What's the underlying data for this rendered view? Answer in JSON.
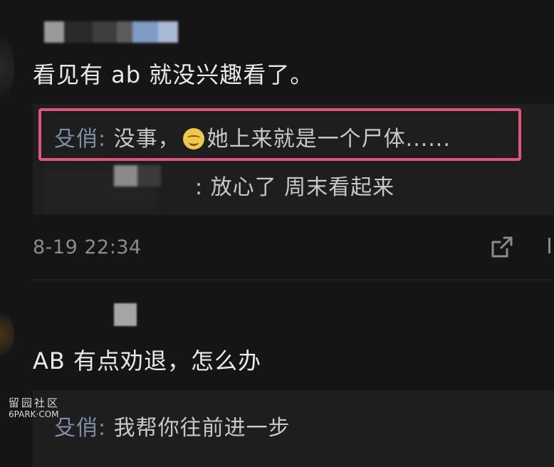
{
  "comments": [
    {
      "text": "看见有 ab 就没兴趣看了。",
      "replies": [
        {
          "author": "殳俏",
          "separator": ":",
          "text_before_emoji": " 没事，",
          "emoji": "smile-emoji",
          "text_after_emoji": "她上来就是一个尸体......"
        },
        {
          "text": ": 放心了  周末看起来"
        }
      ],
      "timestamp": "8-19 22:34"
    },
    {
      "text": "AB 有点劝退，怎么办",
      "replies": [
        {
          "author": "殳俏",
          "separator": ":",
          "text": " 我帮你往前进一步"
        }
      ]
    }
  ],
  "watermark": {
    "line1": "留园社区",
    "line2": "6PARK·COM"
  },
  "colors": {
    "background": "#151515",
    "highlight_border": "#e0567a",
    "author": "#7d8fa8"
  },
  "icons": [
    "share-icon",
    "smile-emoji"
  ]
}
